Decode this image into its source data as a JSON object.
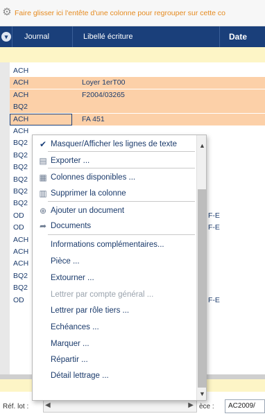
{
  "groupbar": {
    "hint": "Faire glisser ici l'entête d'une colonne pour regrouper sur cette co"
  },
  "header": {
    "journal": "Journal",
    "libelle": "Libellé écriture",
    "date": "Date"
  },
  "rows": [
    {
      "journal": "ACH",
      "libelle": "",
      "date": ""
    },
    {
      "journal": "ACH",
      "libelle": "Loyer 1erT00",
      "date": ""
    },
    {
      "journal": "ACH",
      "libelle": "F2004/03265",
      "date": ""
    },
    {
      "journal": "BQ2",
      "libelle": "",
      "date": ""
    },
    {
      "journal": "ACH",
      "libelle": "FA 451",
      "date": ""
    },
    {
      "journal": "ACH",
      "libelle": "",
      "date": ""
    },
    {
      "journal": "BQ2",
      "libelle": "",
      "date": ""
    },
    {
      "journal": "BQ2",
      "libelle": "",
      "date": ""
    },
    {
      "journal": "BQ2",
      "libelle": "",
      "date": ""
    },
    {
      "journal": "BQ2",
      "libelle": "",
      "date": ""
    },
    {
      "journal": "BQ2",
      "libelle": "",
      "date": ""
    },
    {
      "journal": "BQ2",
      "libelle": "",
      "date": ""
    },
    {
      "journal": "OD",
      "libelle": "",
      "date": "F-E"
    },
    {
      "journal": "OD",
      "libelle": "",
      "date": "F-E"
    },
    {
      "journal": "ACH",
      "libelle": "",
      "date": ""
    },
    {
      "journal": "ACH",
      "libelle": "",
      "date": ""
    },
    {
      "journal": "ACH",
      "libelle": "",
      "date": ""
    },
    {
      "journal": "BQ2",
      "libelle": "",
      "date": ""
    },
    {
      "journal": "BQ2",
      "libelle": "",
      "date": ""
    },
    {
      "journal": "OD",
      "libelle": "",
      "date": "F-E"
    }
  ],
  "menu": {
    "items": [
      {
        "icon": "check-icon",
        "label": "Masquer/Afficher les lignes de texte",
        "enabled": true
      },
      {
        "icon": "export-icon",
        "label": "Exporter ...",
        "enabled": true
      },
      {
        "icon": "columns-icon",
        "label": "Colonnes disponibles ...",
        "enabled": true
      },
      {
        "icon": "delete-column-icon",
        "label": "Supprimer la colonne",
        "enabled": true
      },
      {
        "icon": "add-icon",
        "label": "Ajouter un document",
        "enabled": true
      },
      {
        "icon": "arrow-icon",
        "label": "Documents",
        "enabled": true
      },
      {
        "icon": "",
        "label": "Informations complémentaires...",
        "enabled": true
      },
      {
        "icon": "",
        "label": "Pièce ...",
        "enabled": true
      },
      {
        "icon": "",
        "label": "Extourner ...",
        "enabled": true
      },
      {
        "icon": "",
        "label": "Lettrer par compte général ...",
        "enabled": false
      },
      {
        "icon": "",
        "label": "Lettrer par rôle tiers ...",
        "enabled": true
      },
      {
        "icon": "",
        "label": "Echéances ...",
        "enabled": true
      },
      {
        "icon": "",
        "label": "Marquer ...",
        "enabled": true
      },
      {
        "icon": "",
        "label": "Répartir ...",
        "enabled": true
      },
      {
        "icon": "",
        "label": "Détail lettrage ...",
        "enabled": true
      }
    ]
  },
  "bottombar": {
    "ref_lot_label": "Réf. lot :",
    "piece_label": "èce :",
    "piece_value": "AC2009/"
  },
  "colors": {
    "header_bg": "#1a3f7a",
    "highlight_row": "#fcd0a8",
    "filter_row": "#fdf5c6",
    "hint_text": "#e58a1f"
  }
}
